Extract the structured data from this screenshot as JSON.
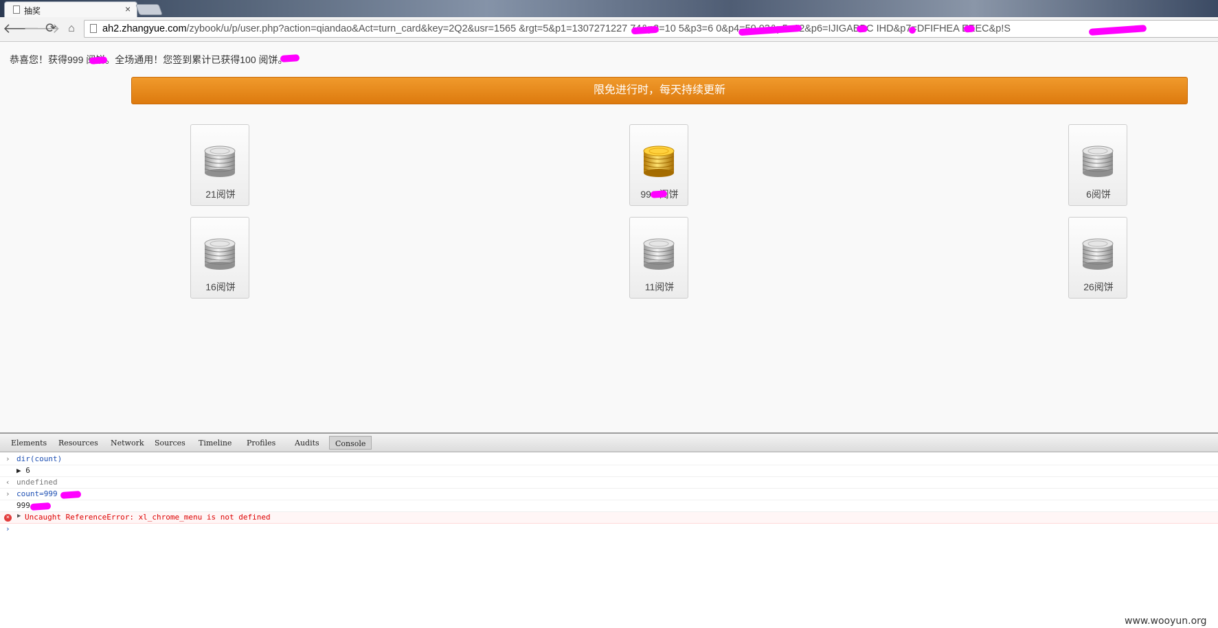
{
  "browser": {
    "tab_title": "抽奖",
    "tab_close": "×",
    "url_host": "ah2.zhangyue.com",
    "url_path": "/zybook/u/p/user.php?action=qiandao&Act=turn_card&key=2Q2&usr=1565              &rgt=5&p1=1307271227               74&p2=10      5&p3=6    0&p4=50    03&p5=12&p6=IJIGABBC                       IHD&p7=DFIFHEA           EEEC&p!S"
  },
  "icons": {
    "back": "back-arrow-icon",
    "forward": "forward-arrow-icon",
    "reload": "reload-icon",
    "home": "home-icon",
    "page": "page-icon",
    "coin_gold": "gold-coin-stack-icon",
    "coin_silver": "silver-coin-stack-icon",
    "error": "error-icon"
  },
  "page": {
    "message": "恭喜您！获得999      阅饼。全场通用！您签到累计已获得100      阅饼。",
    "banner": "限免进行时，每天持续更新",
    "cards": [
      {
        "label": "21阅饼",
        "coin": "silver"
      },
      {
        "label": "999      阅饼",
        "coin": "gold"
      },
      {
        "label": "6阅饼",
        "coin": "silver"
      },
      {
        "label": "16阅饼",
        "coin": "silver"
      },
      {
        "label": "11阅饼",
        "coin": "silver"
      },
      {
        "label": "26阅饼",
        "coin": "silver"
      }
    ]
  },
  "devtools": {
    "tabs": [
      "Elements",
      "Resources",
      "Network",
      "Sources",
      "Timeline",
      "Profiles",
      "Audits",
      "Console"
    ],
    "active_tab": "Console",
    "console": [
      {
        "kind": "cmd",
        "gutter": "›",
        "text": "dir(count)"
      },
      {
        "kind": "result",
        "gutter": "",
        "text": "▶ 6"
      },
      {
        "kind": "undef",
        "gutter": "‹",
        "text": "undefined"
      },
      {
        "kind": "cmd",
        "gutter": "›",
        "text": "count=999"
      },
      {
        "kind": "result",
        "gutter": "",
        "text": "999"
      },
      {
        "kind": "err",
        "gutter": "",
        "text": "Uncaught ReferenceError: xl_chrome_menu is not defined"
      },
      {
        "kind": "prompt",
        "gutter": "›",
        "text": ""
      }
    ]
  },
  "watermark": "www.wooyun.org",
  "colors": {
    "banner": "#e8891d",
    "redaction": "#ff00ff",
    "console_command": "#1d4fb3",
    "console_error": "#dd0000"
  }
}
